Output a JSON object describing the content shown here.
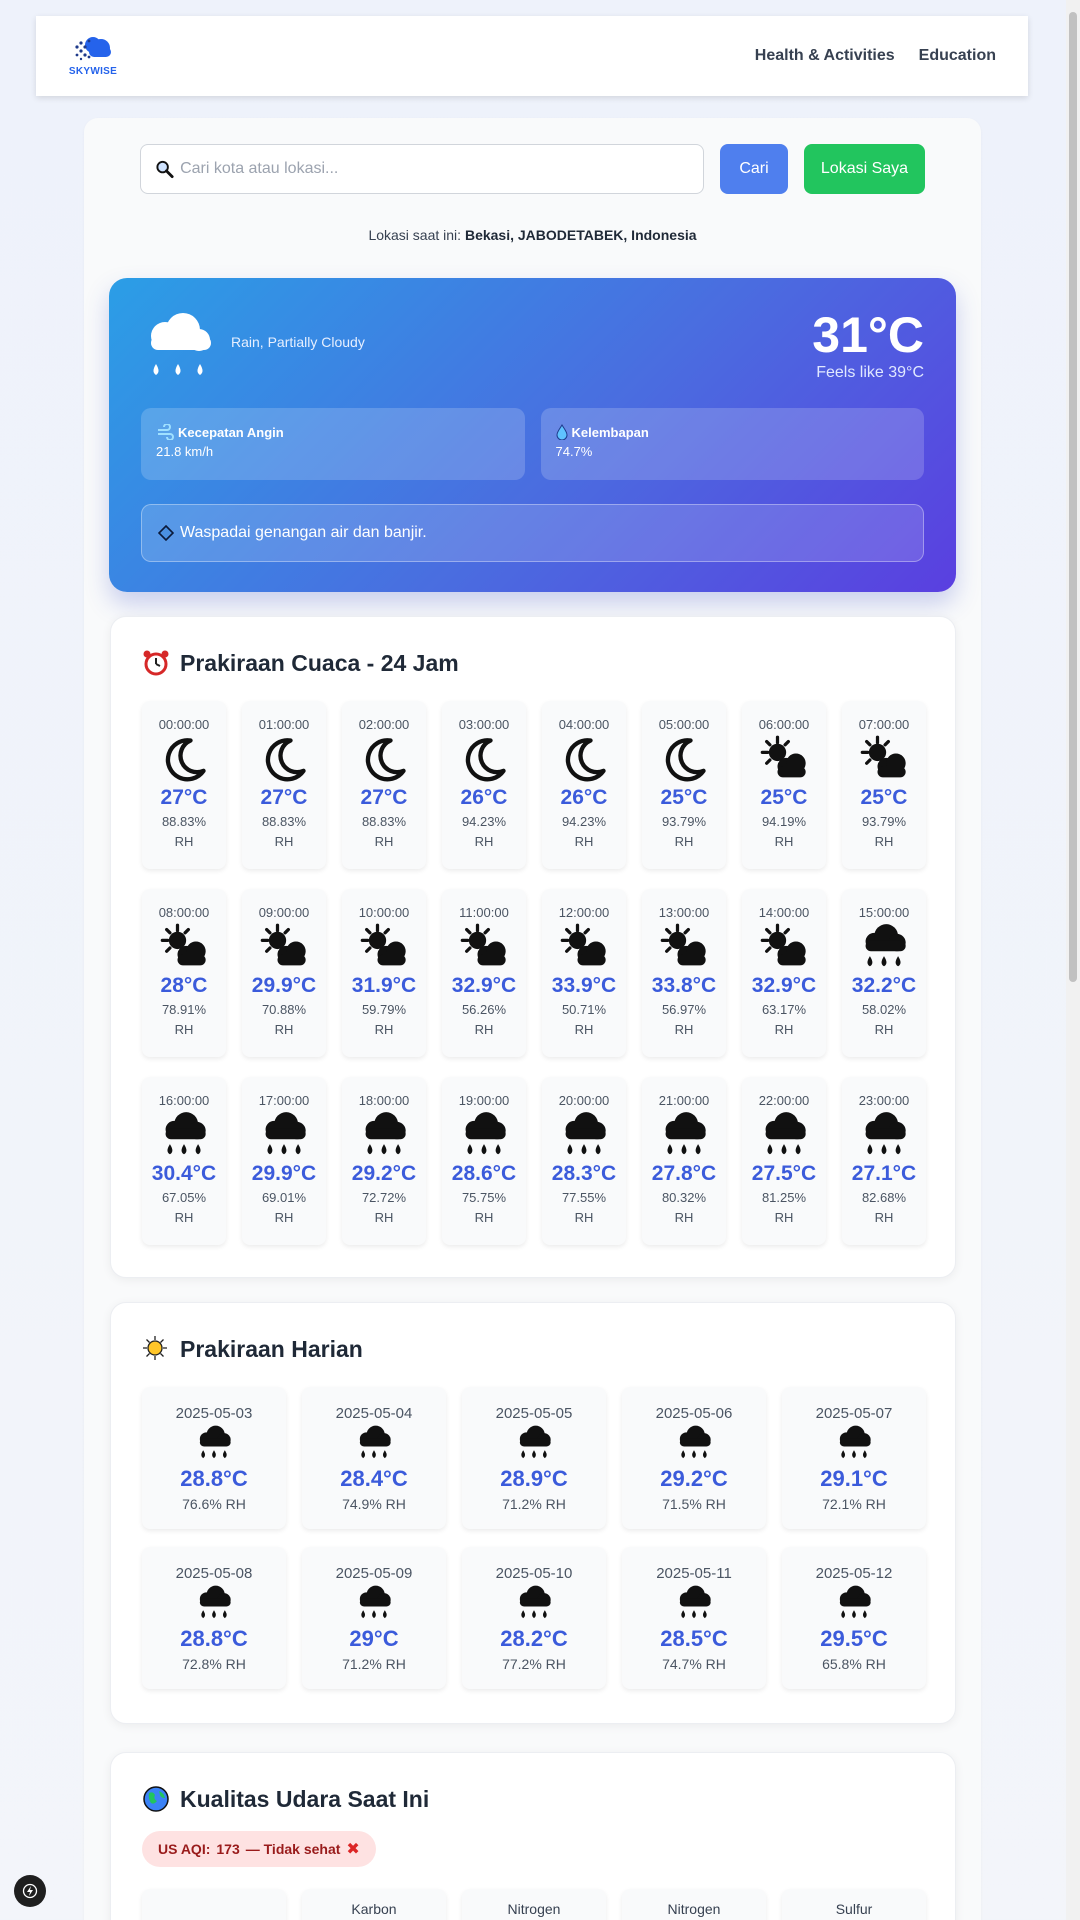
{
  "brand": {
    "name": "SKYWISE"
  },
  "nav": {
    "links": [
      "Health & Activities",
      "Education"
    ]
  },
  "search": {
    "placeholder": "Cari kota atau lokasi...",
    "value": "",
    "search_button": "Cari",
    "location_button": "Lokasi Saya"
  },
  "location": {
    "prefix": "Lokasi saat ini:",
    "name": "Bekasi, JABODETABEK, Indonesia"
  },
  "current": {
    "condition": "Rain, Partially Cloudy",
    "icon": "rain-cloud-icon",
    "temperature": "31°C",
    "feels_like": "Feels like 39°C",
    "wind": {
      "label": "Kecepatan Angin",
      "value": "21.8 km/h",
      "icon": "wind-icon"
    },
    "humidity": {
      "label": "Kelembapan",
      "value": "74.7%",
      "icon": "droplet-icon"
    },
    "alert": "Waspadai genangan air dan banjir."
  },
  "hourly": {
    "title": "Prakiraan Cuaca - 24 Jam",
    "icon": "alarm-clock-icon",
    "items": [
      {
        "time": "00:00:00",
        "icon": "moon",
        "temp": "27°C",
        "rh": "88.83%",
        "unit": "RH"
      },
      {
        "time": "01:00:00",
        "icon": "moon",
        "temp": "27°C",
        "rh": "88.83%",
        "unit": "RH"
      },
      {
        "time": "02:00:00",
        "icon": "moon",
        "temp": "27°C",
        "rh": "88.83%",
        "unit": "RH"
      },
      {
        "time": "03:00:00",
        "icon": "moon",
        "temp": "26°C",
        "rh": "94.23%",
        "unit": "RH"
      },
      {
        "time": "04:00:00",
        "icon": "moon",
        "temp": "26°C",
        "rh": "94.23%",
        "unit": "RH"
      },
      {
        "time": "05:00:00",
        "icon": "moon",
        "temp": "25°C",
        "rh": "93.79%",
        "unit": "RH"
      },
      {
        "time": "06:00:00",
        "icon": "sun-cloud",
        "temp": "25°C",
        "rh": "94.19%",
        "unit": "RH"
      },
      {
        "time": "07:00:00",
        "icon": "sun-cloud",
        "temp": "25°C",
        "rh": "93.79%",
        "unit": "RH"
      },
      {
        "time": "08:00:00",
        "icon": "sun-cloud",
        "temp": "28°C",
        "rh": "78.91%",
        "unit": "RH"
      },
      {
        "time": "09:00:00",
        "icon": "sun-cloud",
        "temp": "29.9°C",
        "rh": "70.88%",
        "unit": "RH"
      },
      {
        "time": "10:00:00",
        "icon": "sun-cloud",
        "temp": "31.9°C",
        "rh": "59.79%",
        "unit": "RH"
      },
      {
        "time": "11:00:00",
        "icon": "sun-cloud",
        "temp": "32.9°C",
        "rh": "56.26%",
        "unit": "RH"
      },
      {
        "time": "12:00:00",
        "icon": "sun-cloud",
        "temp": "33.9°C",
        "rh": "50.71%",
        "unit": "RH"
      },
      {
        "time": "13:00:00",
        "icon": "sun-cloud",
        "temp": "33.8°C",
        "rh": "56.97%",
        "unit": "RH"
      },
      {
        "time": "14:00:00",
        "icon": "sun-cloud",
        "temp": "32.9°C",
        "rh": "63.17%",
        "unit": "RH"
      },
      {
        "time": "15:00:00",
        "icon": "rain",
        "temp": "32.2°C",
        "rh": "58.02%",
        "unit": "RH"
      },
      {
        "time": "16:00:00",
        "icon": "rain",
        "temp": "30.4°C",
        "rh": "67.05%",
        "unit": "RH"
      },
      {
        "time": "17:00:00",
        "icon": "rain",
        "temp": "29.9°C",
        "rh": "69.01%",
        "unit": "RH"
      },
      {
        "time": "18:00:00",
        "icon": "rain",
        "temp": "29.2°C",
        "rh": "72.72%",
        "unit": "RH"
      },
      {
        "time": "19:00:00",
        "icon": "rain",
        "temp": "28.6°C",
        "rh": "75.75%",
        "unit": "RH"
      },
      {
        "time": "20:00:00",
        "icon": "rain",
        "temp": "28.3°C",
        "rh": "77.55%",
        "unit": "RH"
      },
      {
        "time": "21:00:00",
        "icon": "rain",
        "temp": "27.8°C",
        "rh": "80.32%",
        "unit": "RH"
      },
      {
        "time": "22:00:00",
        "icon": "rain",
        "temp": "27.5°C",
        "rh": "81.25%",
        "unit": "RH"
      },
      {
        "time": "23:00:00",
        "icon": "rain",
        "temp": "27.1°C",
        "rh": "82.68%",
        "unit": "RH"
      }
    ]
  },
  "daily": {
    "title": "Prakiraan Harian",
    "icon": "sun-behind-cloud-icon",
    "items": [
      {
        "date": "2025-05-03",
        "icon": "rain",
        "temp": "28.8°C",
        "rh": "76.6% RH"
      },
      {
        "date": "2025-05-04",
        "icon": "rain",
        "temp": "28.4°C",
        "rh": "74.9% RH"
      },
      {
        "date": "2025-05-05",
        "icon": "rain",
        "temp": "28.9°C",
        "rh": "71.2% RH"
      },
      {
        "date": "2025-05-06",
        "icon": "rain",
        "temp": "29.2°C",
        "rh": "71.5% RH"
      },
      {
        "date": "2025-05-07",
        "icon": "rain",
        "temp": "29.1°C",
        "rh": "72.1% RH"
      },
      {
        "date": "2025-05-08",
        "icon": "rain",
        "temp": "28.8°C",
        "rh": "72.8% RH"
      },
      {
        "date": "2025-05-09",
        "icon": "rain",
        "temp": "29°C",
        "rh": "71.2% RH"
      },
      {
        "date": "2025-05-10",
        "icon": "rain",
        "temp": "28.2°C",
        "rh": "77.2% RH"
      },
      {
        "date": "2025-05-11",
        "icon": "rain",
        "temp": "28.5°C",
        "rh": "74.7% RH"
      },
      {
        "date": "2025-05-12",
        "icon": "rain",
        "temp": "29.5°C",
        "rh": "65.8% RH"
      }
    ]
  },
  "air_quality": {
    "title": "Kualitas Udara Saat Ini",
    "icon": "globe-icon",
    "aqi_label": "US AQI:",
    "aqi_value": "173",
    "aqi_status": "— Tidak sehat",
    "pollutants": [
      "",
      "Karbon",
      "Nitrogen",
      "Nitrogen",
      "Sulfur"
    ]
  },
  "colors": {
    "primary": "#3b5bdb",
    "search_button": "#4f7fee",
    "location_button": "#22c55e"
  }
}
